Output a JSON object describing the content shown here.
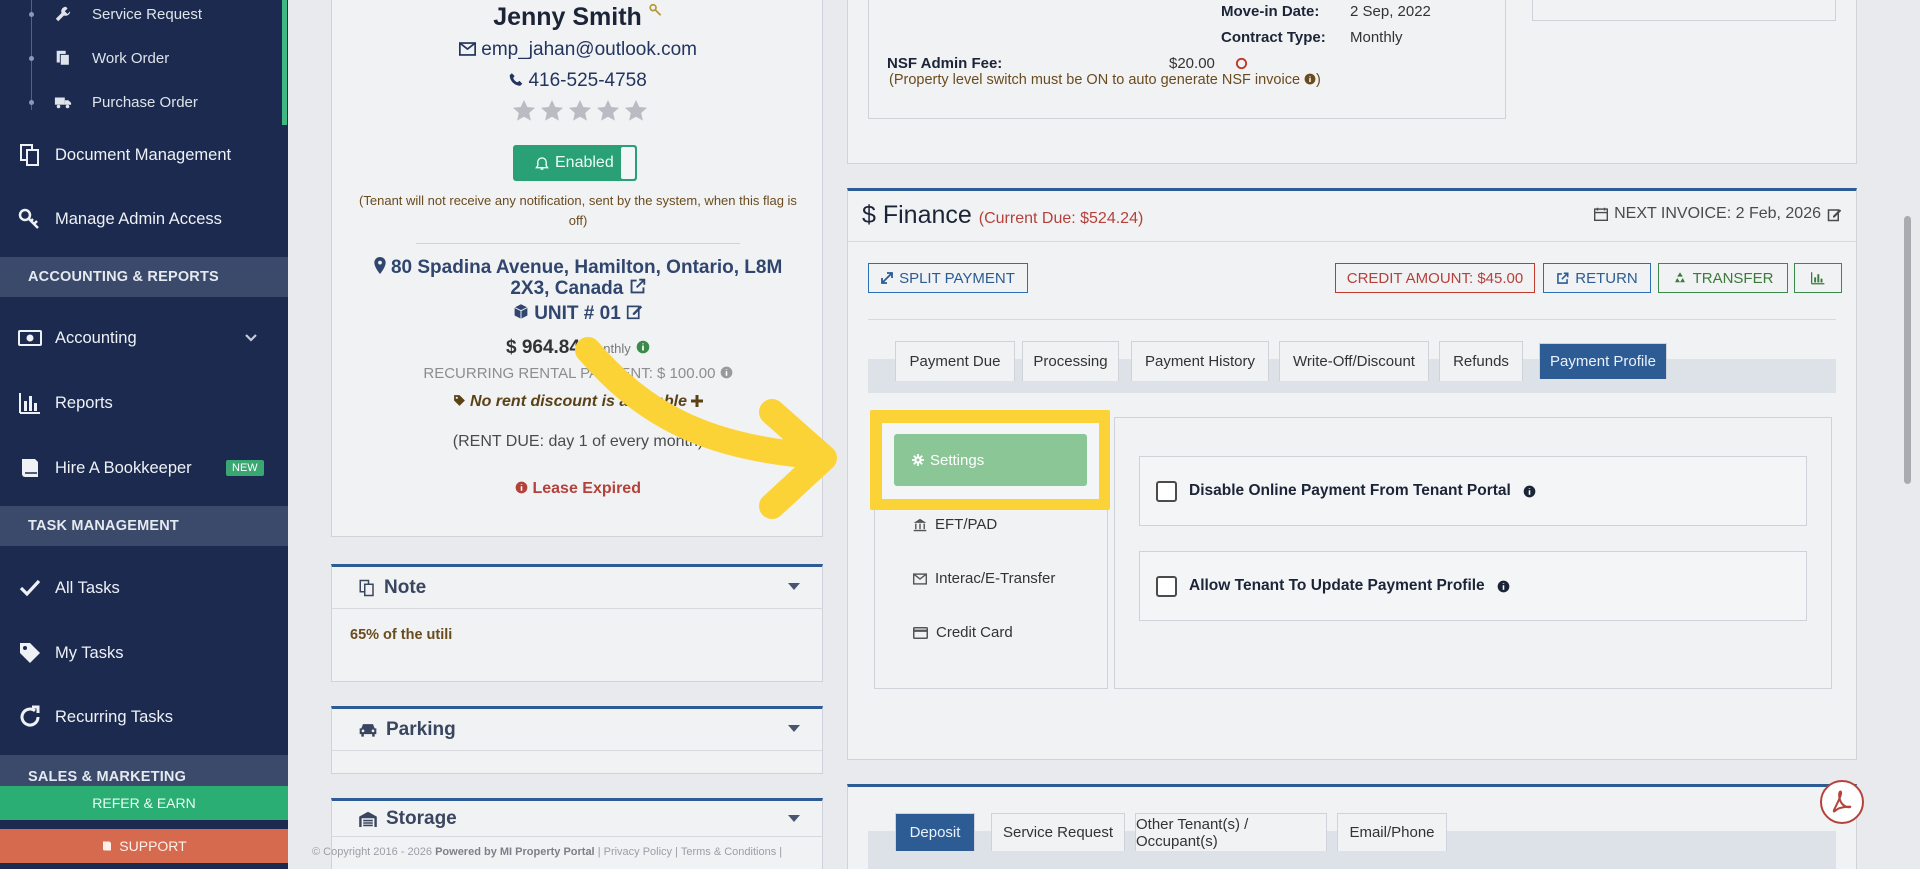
{
  "sidebar": {
    "sub_items": [
      {
        "label": "Service Request",
        "icon": "wrench-icon"
      },
      {
        "label": "Work Order",
        "icon": "document-copy-icon"
      },
      {
        "label": "Purchase Order",
        "icon": "truck-icon"
      }
    ],
    "items_top": [
      {
        "label": "Document Management",
        "icon": "documents-icon"
      },
      {
        "label": "Manage Admin Access",
        "icon": "key-icon"
      }
    ],
    "section_accounting": "ACCOUNTING & REPORTS",
    "items_accounting": [
      {
        "label": "Accounting",
        "icon": "money-icon"
      },
      {
        "label": "Reports",
        "icon": "bar-chart-icon"
      },
      {
        "label": "Hire A Bookkeeper",
        "icon": "book-icon",
        "badge": "NEW"
      }
    ],
    "section_task": "TASK MANAGEMENT",
    "items_task": [
      {
        "label": "All Tasks",
        "icon": "check-icon"
      },
      {
        "label": "My Tasks",
        "icon": "tag-icon"
      },
      {
        "label": "Recurring Tasks",
        "icon": "refresh-icon"
      }
    ],
    "section_sales": "SALES & MARKETING",
    "refer_label": "REFER & EARN",
    "support_label": "SUPPORT"
  },
  "tenant": {
    "name": "Jenny Smith",
    "email": "emp_jahan@outlook.com",
    "phone": "416-525-4758",
    "notify_label": "Enabled",
    "notify_note": "(Tenant will not receive any notification, sent by the system, when this flag is off)",
    "address": "80 Spadina Avenue, Hamilton, Ontario, L8M 2X3, Canada",
    "unit": "UNIT # 01",
    "rent": "$ 964.84",
    "rent_period": "Monthly",
    "recurring": "RECURRING RENTAL PAYMENT: $ 100.00",
    "discount": "No rent discount is available",
    "rent_due": "(RENT DUE: day 1 of every month)",
    "lease_status": "Lease Expired"
  },
  "panels": {
    "note_title": "Note",
    "note_text": "65% of the utili",
    "parking_title": "Parking",
    "storage_title": "Storage"
  },
  "contract": {
    "movein_label": "Move-in Date:",
    "movein_value": "2 Sep, 2022",
    "type_label": "Contract Type:",
    "type_value": "Monthly",
    "nsf_label": "NSF Admin Fee:",
    "nsf_value": "$20.00",
    "nsf_note": "(Property level switch must be ON to auto generate NSF invoice"
  },
  "finance": {
    "title": "Finance",
    "current_due": "(Current Due: $524.24)",
    "next_invoice": "NEXT INVOICE: 2 Feb, 2026",
    "split_payment": "SPLIT PAYMENT",
    "credit_amount": "CREDIT AMOUNT: $45.00",
    "return": "RETURN",
    "transfer": "TRANSFER",
    "tabs": [
      "Payment Due",
      "Processing",
      "Payment History",
      "Write-Off/Discount",
      "Refunds",
      "Payment Profile"
    ],
    "active_tab": "Payment Profile",
    "menu": {
      "settings": "Settings",
      "eft": "EFT/PAD",
      "interac": "Interac/E-Transfer",
      "credit": "Credit Card"
    },
    "options": {
      "disable_online": "Disable Online Payment From Tenant Portal",
      "allow_update": "Allow Tenant To Update Payment Profile"
    }
  },
  "bottom_tabs": [
    "Deposit",
    "Service Request",
    "Other Tenant(s) / Occupant(s)",
    "Email/Phone"
  ],
  "footer": {
    "copyright": "© Copyright 2016 - 2026",
    "powered": "Powered by MI Property Portal",
    "links": "| Privacy Policy | Terms & Conditions |"
  },
  "colors": {
    "sidebar_bg": "#1b2a4e",
    "accent_blue": "#2c5c93",
    "highlight_yellow": "#fcd337",
    "settings_green": "#8bc697",
    "credit_red": "#b5413b"
  }
}
